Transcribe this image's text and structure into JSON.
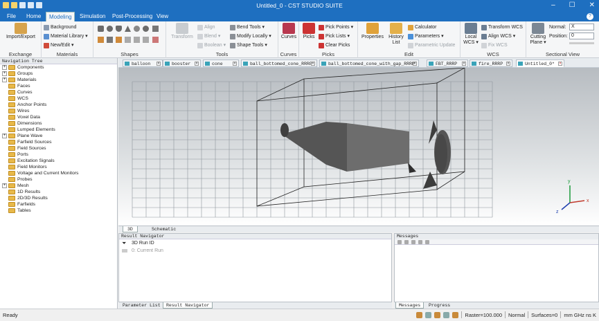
{
  "window": {
    "title": "Untitled_0 - CST STUDIO SUITE"
  },
  "ribbon_tabs": [
    "File",
    "Home",
    "Modeling",
    "Simulation",
    "Post-Processing",
    "View"
  ],
  "ribbon": {
    "exchange": {
      "group": "Exchange",
      "import_export": "Import/Export"
    },
    "materials": {
      "group": "Materials",
      "background": "Background",
      "material_library": "Material Library ▾",
      "new_edit": "New/Edit ▾"
    },
    "shapes": {
      "group": "Shapes"
    },
    "tools": {
      "group": "Tools",
      "transform": "Transform",
      "align": "Align",
      "blend": "Blend ▾",
      "boolean": "Boolean ▾",
      "bend_tools": "Bend Tools ▾",
      "modify_locally": "Modify Locally ▾",
      "shape_tools": "Shape Tools ▾"
    },
    "curves": {
      "group": "Curves",
      "curves": "Curves"
    },
    "picks": {
      "group": "Picks",
      "picks": "Picks",
      "pick_points": "Pick Points ▾",
      "pick_lists": "Pick Lists ▾",
      "clear_picks": "Clear Picks"
    },
    "edit": {
      "group": "Edit",
      "properties": "Properties",
      "history_list": "History List",
      "calculator": "Calculator",
      "parameters": "Parameters ▾",
      "parametric_update": "Parametric Update"
    },
    "wcs": {
      "group": "WCS",
      "local_wcs": "Local WCS ▾",
      "transform_wcs": "Transform WCS",
      "align_wcs": "Align WCS ▾",
      "fix_wcs": "Fix WCS"
    },
    "sectional_view": {
      "group": "Sectional View",
      "cutting_plane": "Cutting Plane ▾",
      "normal_label": "Normal:",
      "normal_value": "X",
      "position_label": "Position:",
      "position_value": "0"
    }
  },
  "nav_tree": {
    "header": "Navigation Tree",
    "items": [
      {
        "label": "Components",
        "exp": "+"
      },
      {
        "label": "Groups",
        "exp": "+"
      },
      {
        "label": "Materials",
        "exp": "+"
      },
      {
        "label": "Faces",
        "exp": ""
      },
      {
        "label": "Curves",
        "exp": ""
      },
      {
        "label": "WCS",
        "exp": ""
      },
      {
        "label": "Anchor Points",
        "exp": ""
      },
      {
        "label": "Wires",
        "exp": ""
      },
      {
        "label": "Voxel Data",
        "exp": ""
      },
      {
        "label": "Dimensions",
        "exp": ""
      },
      {
        "label": "Lumped Elements",
        "exp": ""
      },
      {
        "label": "Plane Wave",
        "exp": "+"
      },
      {
        "label": "Farfield Sources",
        "exp": ""
      },
      {
        "label": "Field Sources",
        "exp": ""
      },
      {
        "label": "Ports",
        "exp": ""
      },
      {
        "label": "Excitation Signals",
        "exp": ""
      },
      {
        "label": "Field Monitors",
        "exp": ""
      },
      {
        "label": "Voltage and Current Monitors",
        "exp": ""
      },
      {
        "label": "Probes",
        "exp": ""
      },
      {
        "label": "Mesh",
        "exp": "+"
      },
      {
        "label": "1D Results",
        "exp": ""
      },
      {
        "label": "2D/3D Results",
        "exp": ""
      },
      {
        "label": "Farfields",
        "exp": ""
      },
      {
        "label": "Tables",
        "exp": ""
      }
    ]
  },
  "doc_tabs": [
    "balloon",
    "booster",
    "cone",
    "ball_bottomed_cone_RRRP",
    "ball_bottomed_cone_with_gap_RRRP",
    "FBT_RRRP",
    "fire_RRRP",
    "Untitled_0*"
  ],
  "view_tabs": [
    "3D",
    "Schematic"
  ],
  "result_nav": {
    "header": "Result Navigator",
    "col": "3D Run ID",
    "row": "0: Current Run"
  },
  "messages": {
    "header": "Messages"
  },
  "bottom_tabs_left": [
    "Parameter List",
    "Result Navigator"
  ],
  "bottom_tabs_right": [
    "Messages",
    "Progress"
  ],
  "status": {
    "ready": "Ready",
    "raster": "Raster=100.000",
    "mode": "Normal",
    "surfaces": "Surfaces=0",
    "units": "mm  GHz  ns  K"
  },
  "axes": {
    "x": "x",
    "y": "y",
    "z": "z"
  },
  "colors": {
    "titlebar": "#1e6fc0",
    "selection": "#c4e0f8"
  }
}
